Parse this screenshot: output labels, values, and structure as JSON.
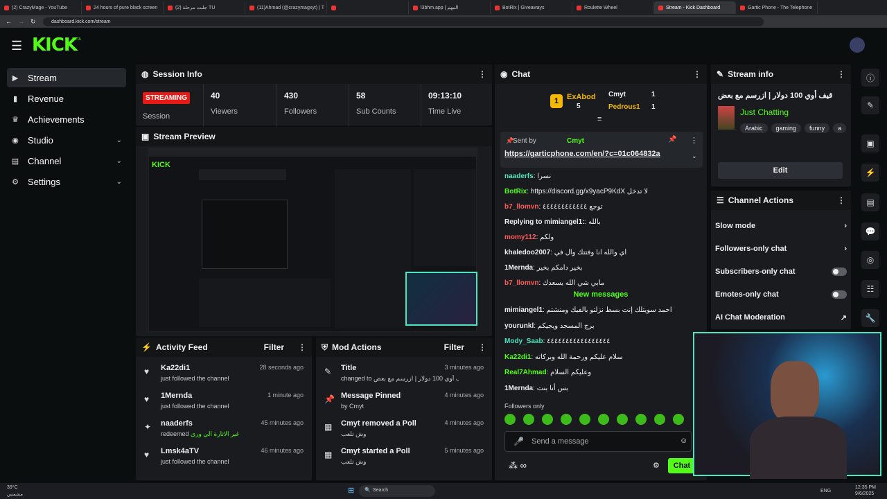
{
  "browser": {
    "tabs": [
      "(2) CrazyMage - YouTube",
      "24 hours of pure black screen",
      "(2) جلبت مرحلة TU",
      "(11)Ahmad (@crazymagxyt) | T",
      "",
      "l3bhm.app | المهم",
      "BotRix | Giveaways",
      "Roulette Wheel",
      "Stream - Kick Dashboard",
      "Gartic Phone - The Telephone"
    ],
    "url": "dashboard.kick.com/stream"
  },
  "nav": {
    "logo": "KICK",
    "logo_beta": "BETA",
    "items": [
      {
        "label": "Stream",
        "icon": "stream-icon"
      },
      {
        "label": "Revenue",
        "icon": "revenue-icon"
      },
      {
        "label": "Achievements",
        "icon": "trophy-icon"
      },
      {
        "label": "Studio",
        "icon": "studio-icon"
      },
      {
        "label": "Channel",
        "icon": "channel-icon"
      },
      {
        "label": "Settings",
        "icon": "gear-icon"
      }
    ]
  },
  "session": {
    "title": "Session Info",
    "status": "STREAMING",
    "status_label": "Session",
    "stats": [
      {
        "value": "40",
        "label": "Viewers"
      },
      {
        "value": "430",
        "label": "Followers"
      },
      {
        "value": "58",
        "label": "Sub Counts"
      },
      {
        "value": "09:13:10",
        "label": "Time Live"
      }
    ]
  },
  "preview": {
    "title": "Stream Preview"
  },
  "activity": {
    "title": "Activity Feed",
    "filter": "Filter",
    "rows": [
      {
        "name": "Ka22di1",
        "sub": "just followed the channel",
        "time": "28 seconds ago"
      },
      {
        "name": "1Mernda",
        "sub": "just followed the channel",
        "time": "1 minute ago"
      },
      {
        "name": "naaderfs",
        "sub": "redeemed",
        "extra": "غير الاثارة الي ورى",
        "time": "45 minutes ago"
      },
      {
        "name": "Lmsk4aTV",
        "sub": "just followed the channel",
        "time": "46 minutes ago"
      }
    ]
  },
  "mod": {
    "title": "Mod Actions",
    "filter": "Filter",
    "rows": [
      {
        "name": "Title",
        "sub": "changed to قيف أوي 100 دولار | ازرسم مع بعض by Cmyt",
        "time": "3 minutes ago"
      },
      {
        "name": "Message Pinned",
        "sub": "by Cmyt",
        "time": "4 minutes ago"
      },
      {
        "name": "Cmyt removed a Poll",
        "sub": "وش تلعب",
        "time": "4 minutes ago"
      },
      {
        "name": "Cmyt started a Poll",
        "sub": "وش تلعب",
        "time": "5 minutes ago"
      }
    ]
  },
  "chat": {
    "title": "Chat",
    "leaderboard": [
      {
        "name": "ExAbod",
        "count": "5"
      },
      {
        "name": "Cmyt",
        "count": "1"
      },
      {
        "name": "Pedrous1",
        "count": "1"
      }
    ],
    "pinned": {
      "sent_by": "Sent by",
      "user": "Cmyt",
      "link": "https://garticphone.com/en/?c=01c064832a"
    },
    "messages": [
      {
        "user": "naaderfs",
        "text": "نسرا",
        "cls": "teal"
      },
      {
        "user": "BotRix",
        "text": "https://discord.gg/x9yacP9KdX لا تدخل",
        "cls": "green"
      },
      {
        "user": "b7_llomvn",
        "text": "توجع ٤٤٤٤٤٤٤٤٤٤٤٤",
        "cls": "red"
      },
      {
        "user": "Replying to mimiangel1:",
        "text": "بالله",
        "cls": ""
      },
      {
        "user": "momy112",
        "text": "ولكم",
        "cls": "red"
      },
      {
        "user": "khaledoo2007",
        "text": "اي والله انا وفتتك وال في",
        "cls": ""
      },
      {
        "user": "1Mernda",
        "text": "بخير دامكم بخير",
        "cls": ""
      },
      {
        "user": "b7_llomvn",
        "text": "مابي شي الله يسعدك",
        "cls": "red"
      }
    ],
    "new_messages": "New messages",
    "messages2": [
      {
        "user": "mimiangel1",
        "text": "احمد سويتلك إنت بسط نزلتو بالفيك ومنشتم",
        "cls": ""
      },
      {
        "user": "yourunkl",
        "text": "برج المسجد ويجيكم",
        "cls": ""
      },
      {
        "user": "Mody_Saab",
        "text": "٤٤٤٤٤٤٤٤٤٤٤٤٤٤٤٤٤",
        "cls": "teal"
      },
      {
        "user": "Ka22di1",
        "text": "سلام عليكم ورحمة الله وبركاته",
        "cls": "green"
      },
      {
        "user": "Real7Ahmad",
        "text": "وعليكم السلام",
        "cls": "green"
      },
      {
        "user": "1Mernda",
        "text": "بس أنا بنت",
        "cls": ""
      }
    ],
    "followers_only": "Followers only",
    "input_placeholder": "Send a message",
    "send": "Chat"
  },
  "stream_info": {
    "title": "Stream info",
    "stream_title": "قيف أوي 100 دولار | ازرسم مع بعض",
    "category": "Just Chatting",
    "tags": [
      "Arabic",
      "gaming",
      "funny",
      "a"
    ],
    "edit": "Edit"
  },
  "channel_actions": {
    "title": "Channel Actions",
    "items": [
      {
        "label": "Slow mode",
        "type": "chevron"
      },
      {
        "label": "Followers-only chat",
        "type": "chevron"
      },
      {
        "label": "Subscribers-only chat",
        "type": "toggle"
      },
      {
        "label": "Emotes-only chat",
        "type": "toggle"
      },
      {
        "label": "AI Chat Moderation",
        "type": "link"
      }
    ]
  },
  "taskbar": {
    "weather": "39°C",
    "weather_sub": "مشمس",
    "search": "Search",
    "lang": "ENG",
    "time": "12:35 PM",
    "date": "9/6/2025"
  },
  "colors": {
    "accent": "#53fc18",
    "live": "#e91916",
    "panel": "#191b1f"
  }
}
